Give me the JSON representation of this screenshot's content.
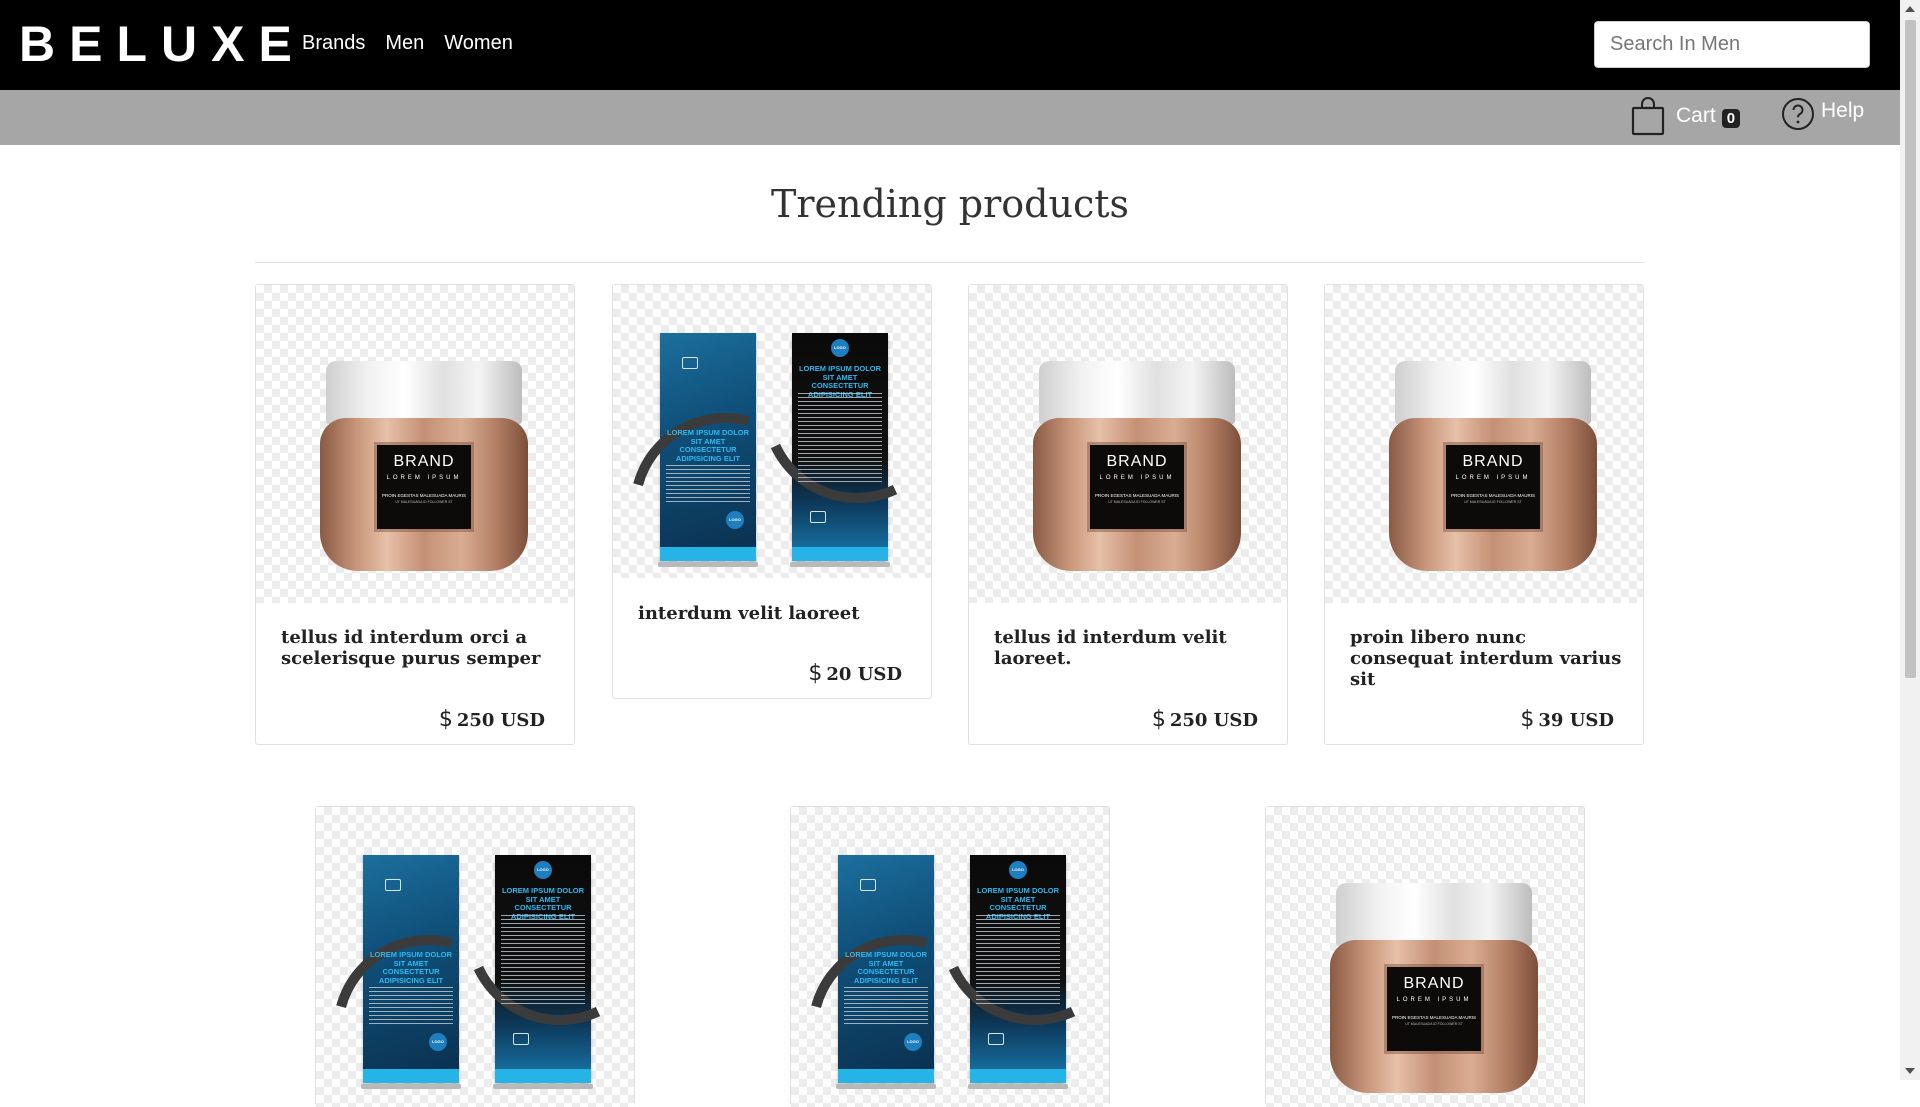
{
  "header": {
    "logo": "BELUXE",
    "nav": [
      "Brands",
      "Men",
      "Women"
    ],
    "search_placeholder": "Search In Men"
  },
  "subbar": {
    "cart_label": "Cart",
    "cart_count": "0",
    "help_label": "Help"
  },
  "main": {
    "title": "Trending products",
    "products": [
      {
        "name": "tellus id interdum orci a scelerisque purus semper",
        "price_symbol": "$",
        "price": "250 USD",
        "image": "jar"
      },
      {
        "name": "interdum velit laoreet",
        "price_symbol": "$",
        "price": "20 USD",
        "image": "banner"
      },
      {
        "name": "tellus id interdum velit laoreet.",
        "price_symbol": "$",
        "price": "250 USD",
        "image": "jar"
      },
      {
        "name": "proin libero nunc consequat interdum varius sit",
        "price_symbol": "$",
        "price": "39 USD",
        "image": "jar"
      },
      {
        "name": "",
        "price_symbol": "",
        "price": "",
        "image": "banner"
      },
      {
        "name": "",
        "price_symbol": "",
        "price": "",
        "image": "banner"
      },
      {
        "name": "",
        "price_symbol": "",
        "price": "",
        "image": "jar"
      }
    ]
  },
  "image_texts": {
    "jar_brand": "BRAND",
    "jar_sub": "LOREM IPSUM",
    "jar_line1": "PROIN EGESTAS MALESUADA MAURIS",
    "jar_line2": "UT MALESUADA ID FOLLOWER ST",
    "banner_heading_1": "LOREM IPSUM DOLOR SIT AMET CONSECTETUR ADIPISICING ELIT",
    "banner_heading_2": "LOREM IPSUM DOLOR SIT AMET CONSECTETUR ADIPISICING ELIT",
    "banner_logo": "LOGO"
  },
  "icons": {
    "cart": "shopping-bag-icon",
    "help": "question-circle-icon"
  },
  "colors": {
    "topbar": "#000000",
    "subbar": "#a6a6a6",
    "text_dark": "#222222"
  }
}
